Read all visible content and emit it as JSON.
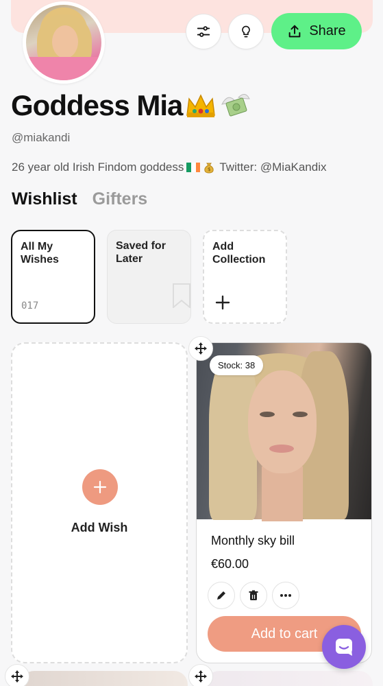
{
  "profile": {
    "name": "Goddess Mia",
    "name_emojis": [
      "crown",
      "money-with-wings"
    ],
    "handle": "@miakandi",
    "bio_part1": "26 year old Irish Findom goddess",
    "bio_part2": "Twitter: @MiaKandix"
  },
  "header": {
    "share_label": "Share",
    "share_color": "#5ef088",
    "banner_color": "#fde3df"
  },
  "tabs": [
    {
      "label": "Wishlist",
      "active": true
    },
    {
      "label": "Gifters",
      "active": false
    }
  ],
  "collections": [
    {
      "label": "All My Wishes",
      "count": "017",
      "selected": true
    },
    {
      "label": "Saved for Later"
    },
    {
      "label": "Add Collection"
    }
  ],
  "add_wish": {
    "label": "Add Wish"
  },
  "wish_card": {
    "stock": "Stock: 38",
    "title": "Monthly sky bill",
    "price": "€60.00",
    "add_to_cart": "Add to cart",
    "accent_color": "#ef9c82"
  },
  "icons": [
    "sliders-icon",
    "lightbulb-icon",
    "upload-icon",
    "bookmark-icon",
    "plus-icon",
    "move-icon",
    "pencil-icon",
    "trash-icon",
    "more-icon",
    "chat-icon"
  ]
}
